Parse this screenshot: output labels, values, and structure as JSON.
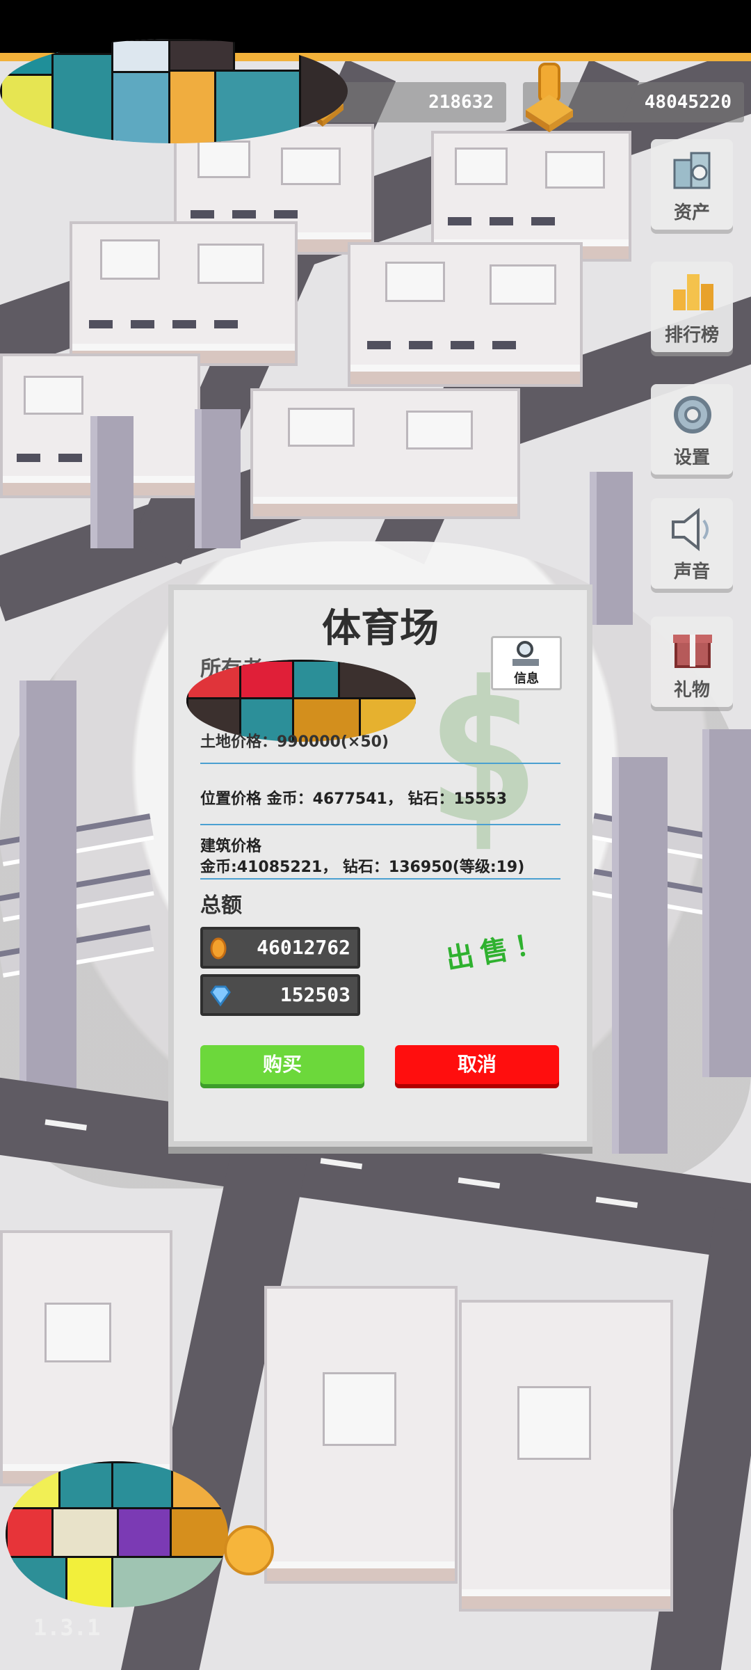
{
  "top_bar": {
    "resource_one_value": "218632",
    "gold_value": "48045220"
  },
  "side_menu": [
    {
      "label": "资产",
      "icon": "assets-icon"
    },
    {
      "label": "排行榜",
      "icon": "leaderboard-icon"
    },
    {
      "label": "设置",
      "icon": "gear-icon"
    },
    {
      "label": "声音",
      "icon": "speaker-icon"
    },
    {
      "label": "礼物",
      "icon": "gift-icon"
    }
  ],
  "dialog": {
    "title": "体育场",
    "owner_label": "所有者",
    "info_label": "信息",
    "land_price_text": "土地价格：990000(×50)",
    "location_price_text": "位置价格 金币：4677541， 钻石：15553",
    "building_price_label": "建筑价格",
    "building_price_text": "金币:41085221， 钻石：136950(等级:19)",
    "total_label": "总额",
    "total_gold": "46012762",
    "total_diamond": "152503",
    "sell_label": "出售！",
    "buy_button": "购买",
    "cancel_button": "取消"
  },
  "version": "1.3.1",
  "colors": {
    "buy": "#6cd83b",
    "cancel": "#ff0e0e",
    "sell_text": "#2fb12f",
    "accent_line": "#4aa0d1"
  }
}
